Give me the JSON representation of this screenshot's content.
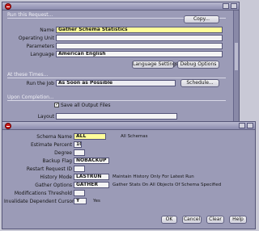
{
  "request_window": {
    "section_run": "Run this Request...",
    "copy_button": "Copy...",
    "name_label": "Name",
    "name_value": "Gather Schema Statistics",
    "operating_unit_label": "Operating Unit",
    "parameters_label": "Parameters",
    "language_label": "Language",
    "language_value": "American English",
    "language_settings_button": "Language Settings...",
    "debug_options_button": "Debug Options",
    "section_times": "At these Times...",
    "run_the_job_label": "Run the Job",
    "run_the_job_value": "As Soon as Possible",
    "schedule_button": "Schedule...",
    "section_completion": "Upon Completion...",
    "save_output_label": "Save all Output Files",
    "layout_label": "Layout"
  },
  "parameters_window": {
    "fields": [
      {
        "label": "Schema Name",
        "value": "ALL",
        "hint": "All Schemas"
      },
      {
        "label": "Estimate Percent",
        "value": "10",
        "hint": ""
      },
      {
        "label": "Degree",
        "value": "",
        "hint": ""
      },
      {
        "label": "Backup Flag",
        "value": "NOBACKUP",
        "hint": ""
      },
      {
        "label": "Restart Request ID",
        "value": "",
        "hint": ""
      },
      {
        "label": "History Mode",
        "value": "LASTRUN",
        "hint": "Maintain History Only For Latest Run"
      },
      {
        "label": "Gather Options",
        "value": "GATHER",
        "hint": "Gather Stats On All Objects Of Schema Specified"
      },
      {
        "label": "Modifications Threshold",
        "value": "",
        "hint": ""
      },
      {
        "label": "Invalidate Dependent Cursors",
        "value": "Y",
        "hint": "Yes"
      }
    ],
    "buttons": {
      "ok": "OK",
      "cancel": "Cancel",
      "clear": "Clear",
      "help": "Help"
    }
  },
  "colors": {
    "window_bg": "#9b9bb7",
    "required_field": "#fffe9a",
    "close_button": "#c81818"
  }
}
